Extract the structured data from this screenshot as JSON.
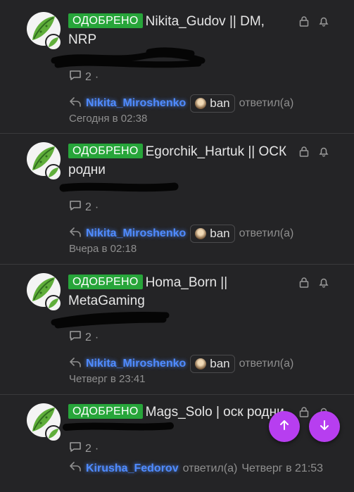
{
  "threads": [
    {
      "prefix": "ОДОБРЕНО",
      "title": "Nikita_Gudov || DM, NRP",
      "replies": "2",
      "last_user": "Nikita_Miroshenko",
      "badge": "ban",
      "action": "ответил(а)",
      "date": "Сегодня в 02:38"
    },
    {
      "prefix": "ОДОБРЕНО",
      "title": "Egorchik_Hartuk || ОСК родни",
      "replies": "2",
      "last_user": "Nikita_Miroshenko",
      "badge": "ban",
      "action": "ответил(а)",
      "date": "Вчера в 02:18"
    },
    {
      "prefix": "ОДОБРЕНО",
      "title": "Homa_Born || MetaGaming",
      "replies": "2",
      "last_user": "Nikita_Miroshenko",
      "badge": "ban",
      "action": "ответил(а)",
      "date": "Четверг в 23:41"
    },
    {
      "prefix": "ОДОБРЕНО",
      "title": "Mags_Solo | оск родни",
      "replies": "2",
      "last_user": "Kirusha_Fedorov",
      "action": "ответил(а)",
      "date": "Четверг в 21:53"
    }
  ],
  "icons": {
    "lock": "lock-icon",
    "bell": "bell-icon",
    "comment": "comment-icon",
    "reply": "reply-arrow-icon",
    "scroll_up": "arrow-up-icon",
    "scroll_down": "arrow-down-icon"
  },
  "colors": {
    "background": "#242426",
    "prefix_green": "#27a53a",
    "username_blue": "#4f8bff",
    "fab_purple": "#b73ef0"
  }
}
